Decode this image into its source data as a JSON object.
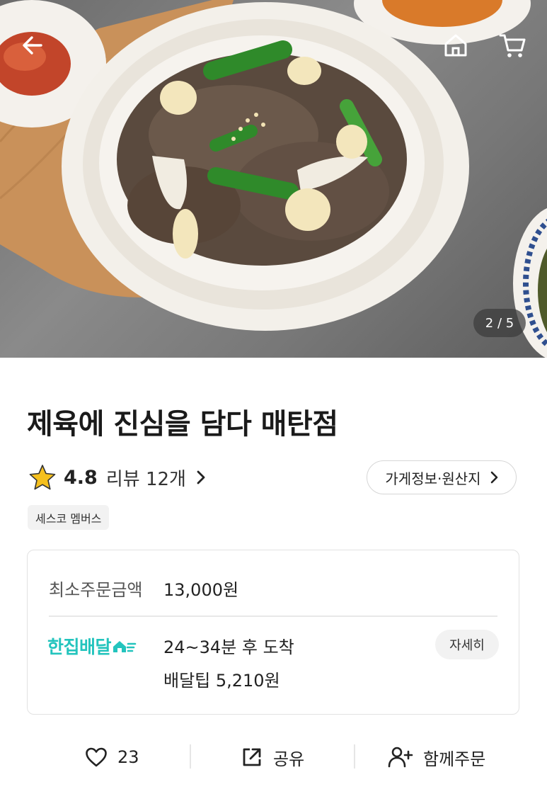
{
  "hero": {
    "image_counter": "2 / 5",
    "icons": {
      "back": "arrow-left-icon",
      "home": "home-icon",
      "cart": "cart-icon"
    }
  },
  "store": {
    "name": "제육에 진심을 담다 매탄점",
    "rating": "4.8",
    "review_label": "리뷰 12개",
    "info_button": "가게정보·원산지",
    "member_badge": "세스코 멤버스"
  },
  "order_info": {
    "min_order_label": "최소주문금액",
    "min_order_value": "13,000원",
    "delivery_brand": "한집배달",
    "arrival_time": "24~34분 후 도착",
    "delivery_tip": "배달팁 5,210원",
    "detail_button": "자세히"
  },
  "actions": {
    "like_count": "23",
    "share_label": "공유",
    "group_order_label": "함께주문"
  },
  "colors": {
    "accent": "#23c4bd",
    "star": "#f5c01e",
    "text": "#222222",
    "border": "#e2e2e2"
  }
}
